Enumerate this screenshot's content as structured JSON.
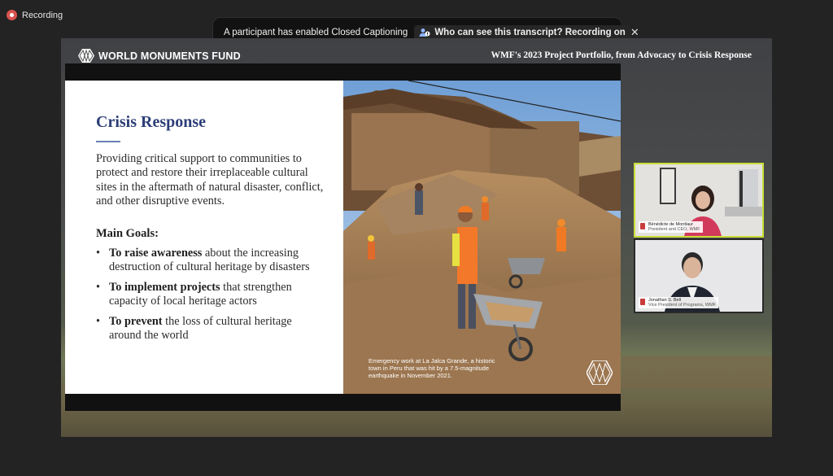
{
  "recording": {
    "label": "Recording"
  },
  "banner": {
    "message": "A participant has enabled Closed Captioning",
    "link": "Who can see this transcript? Recording on",
    "close": "✕"
  },
  "shared_screen": {
    "org_logo": "WORLD MONUMENTS FUND",
    "deck_title": "WMF's 2023 Project Portfolio, from Advocacy to Crisis Response",
    "slide": {
      "heading": "Crisis Response",
      "lead": "Providing critical support to communities to protect and restore their irreplaceable cultural sites in the aftermath of natural disaster, conflict, and other disruptive events.",
      "goals_heading": "Main Goals:",
      "goals": [
        {
          "bold": "To raise awareness",
          "rest": " about the increasing destruction of cultural heritage by disasters"
        },
        {
          "bold": "To implement projects",
          "rest": " that strengthen capacity of local heritage actors"
        },
        {
          "bold": "To prevent",
          "rest": " the loss of cultural heritage around the world"
        }
      ],
      "photo_caption": "Emergency work at La Jalca Grande, a historic town in Peru that was hit by a 7.5-magnitude earthquake in November 2021."
    }
  },
  "participants": [
    {
      "name": "Bénédicte de Montlaur",
      "title": "President and CEO, WMF",
      "active_speaker": true
    },
    {
      "name": "Jonathan S. Bell",
      "title": "Vice President of Programs, WMF",
      "active_speaker": false
    }
  ],
  "colors": {
    "active_speaker_border": "#c9df36",
    "heading": "#2c3e78",
    "recording_dot": "#d9534f"
  }
}
